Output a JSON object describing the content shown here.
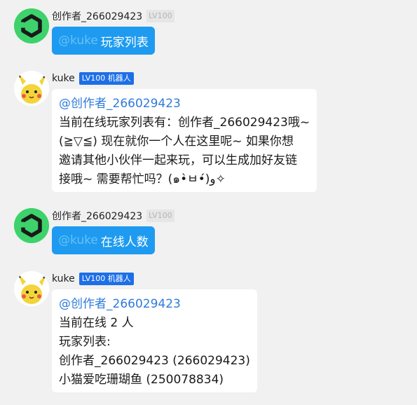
{
  "messages": [
    {
      "sender": "创作者_266029423",
      "level": "LV100",
      "mention": "@kuke",
      "text": "玩家列表"
    },
    {
      "sender": "kuke",
      "badge": "LV100 机器人",
      "mention": "@创作者_266029423",
      "lines": [
        "当前在线玩家列表有：创作者_266029423哦~",
        "(≧▽≦) 现在就你一个人在这里呢~ 如果你想",
        "邀请其他小伙伴一起来玩，可以生成加好友链",
        "接哦~ 需要帮忙吗？(๑•̀ㅂ•́)و✧"
      ]
    },
    {
      "sender": "创作者_266029423",
      "level": "LV100",
      "mention": "@kuke",
      "text": "在线人数"
    },
    {
      "sender": "kuke",
      "badge": "LV100 机器人",
      "mention": "@创作者_266029423",
      "lines": [
        "当前在线 2 人",
        "玩家列表:",
        "创作者_266029423 (266029423)",
        "小猫爱吃珊瑚鱼 (250078834)"
      ]
    }
  ]
}
